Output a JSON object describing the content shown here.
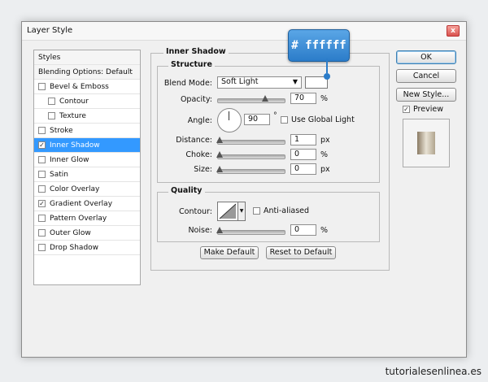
{
  "dialog": {
    "title": "Layer Style",
    "close_glyph": "x"
  },
  "styles_list": {
    "header": "Styles",
    "blending_options": "Blending Options: Default",
    "items": [
      {
        "label": "Bevel & Emboss",
        "checked": false
      },
      {
        "label": "Contour",
        "checked": false
      },
      {
        "label": "Texture",
        "checked": false
      },
      {
        "label": "Stroke",
        "checked": false
      },
      {
        "label": "Inner Shadow",
        "checked": true,
        "selected": true
      },
      {
        "label": "Inner Glow",
        "checked": false
      },
      {
        "label": "Satin",
        "checked": false
      },
      {
        "label": "Color Overlay",
        "checked": false
      },
      {
        "label": "Gradient Overlay",
        "checked": true
      },
      {
        "label": "Pattern Overlay",
        "checked": false
      },
      {
        "label": "Outer Glow",
        "checked": false
      },
      {
        "label": "Drop Shadow",
        "checked": false
      }
    ]
  },
  "buttons": {
    "ok": "OK",
    "cancel": "Cancel",
    "new_style": "New Style...",
    "preview_label": "Preview",
    "make_default": "Make Default",
    "reset_default": "Reset to Default"
  },
  "inner_shadow": {
    "section_title": "Inner Shadow",
    "structure": {
      "title": "Structure",
      "blend_mode_label": "Blend Mode:",
      "blend_mode_value": "Soft Light",
      "shadow_color": "#ffffff",
      "opacity_label": "Opacity:",
      "opacity_value": "70",
      "angle_label": "Angle:",
      "angle_value": "90",
      "degree_symbol": "°",
      "use_global_light_label": "Use Global Light",
      "distance_label": "Distance:",
      "distance_value": "1",
      "choke_label": "Choke:",
      "choke_value": "0",
      "size_label": "Size:",
      "size_value": "0",
      "unit_px": "px",
      "unit_pct": "%"
    },
    "quality": {
      "title": "Quality",
      "contour_label": "Contour:",
      "anti_aliased_label": "Anti-aliased",
      "noise_label": "Noise:",
      "noise_value": "0",
      "unit_pct": "%"
    }
  },
  "callout": {
    "text": "# ffffff"
  },
  "watermark": "tutorialesenlinea.es",
  "colors": {
    "selected_row": "#3399ff",
    "callout": "#2b7cc9"
  }
}
